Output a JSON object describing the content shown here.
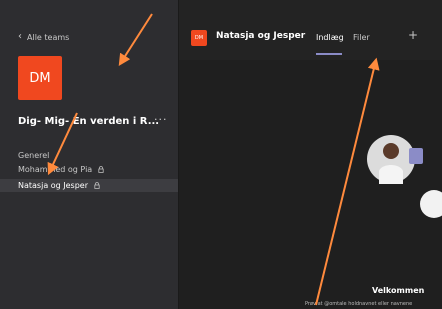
{
  "sidebar": {
    "back_label": "Alle teams",
    "team_avatar": "DM",
    "team_name": "Dig- Mig- En verden i R...",
    "more_label": "···",
    "channels": [
      {
        "label": "Generel"
      },
      {
        "label": "Mohammed og Pia",
        "locked": true
      },
      {
        "label": "Natasja og Jesper",
        "locked": true,
        "selected": true
      }
    ]
  },
  "header": {
    "avatar": "DM",
    "title": "Natasja og Jesper",
    "tabs": [
      {
        "label": "Indlæg",
        "active": true
      },
      {
        "label": "Filer"
      }
    ],
    "add_tab_label": "+"
  },
  "main": {
    "welcome": "Velkommen",
    "hint": "Prøv at @omtale holdnavnet eller navnene"
  },
  "colors": {
    "accent": "#f0481f",
    "tab_underline": "#8b8cc7",
    "annotation_arrow": "#ff8a3d"
  }
}
